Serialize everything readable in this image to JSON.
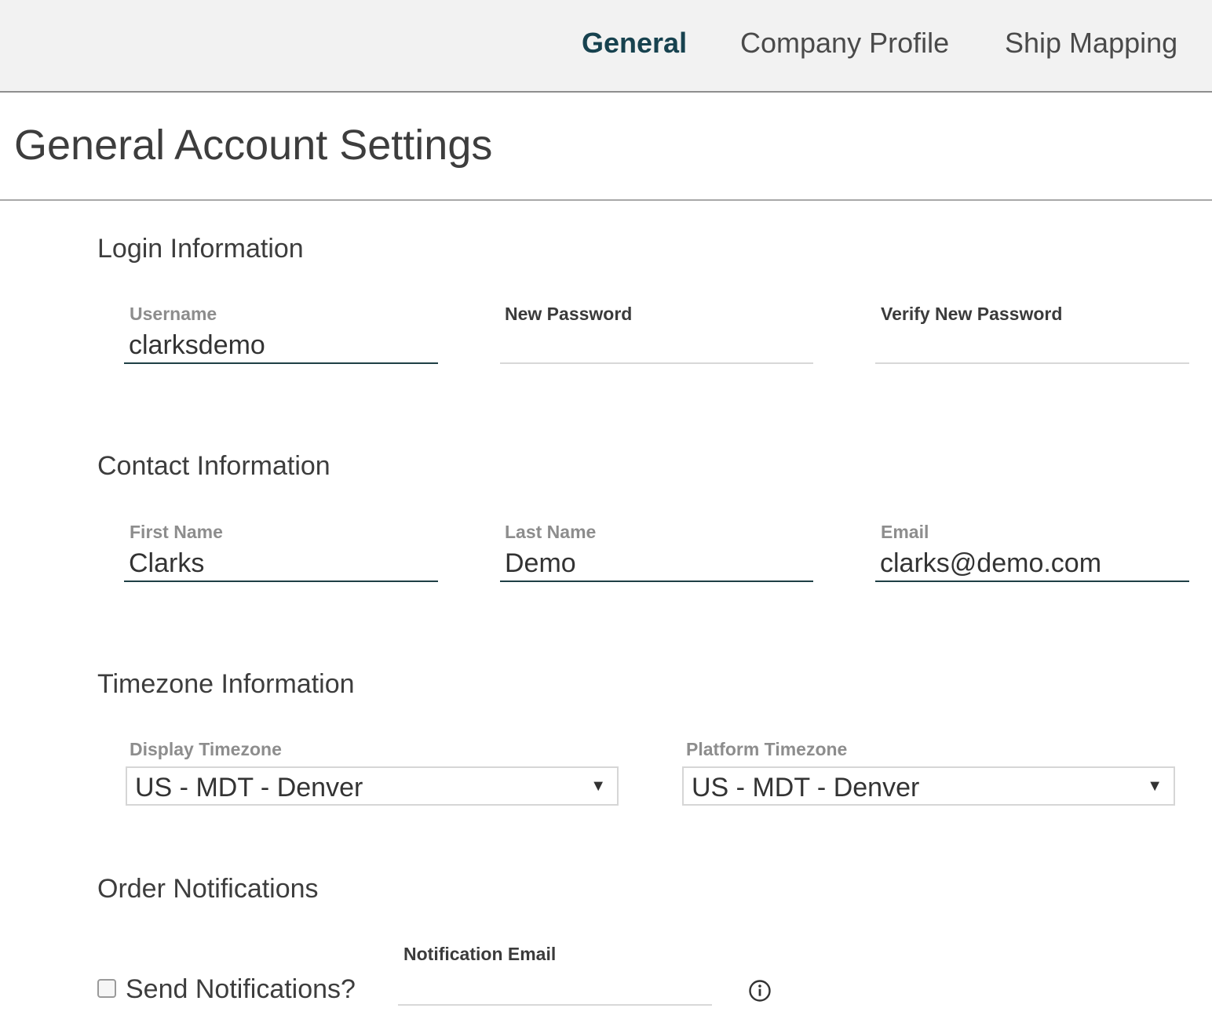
{
  "nav": {
    "tabs": [
      {
        "label": "General",
        "active": true
      },
      {
        "label": "Company Profile",
        "active": false
      },
      {
        "label": "Ship Mapping",
        "active": false
      }
    ]
  },
  "page": {
    "title": "General Account Settings"
  },
  "login": {
    "title": "Login Information",
    "username_label": "Username",
    "username_value": "clarksdemo",
    "new_password_label": "New Password",
    "new_password_value": "",
    "verify_password_label": "Verify New Password",
    "verify_password_value": ""
  },
  "contact": {
    "title": "Contact Information",
    "first_name_label": "First Name",
    "first_name_value": "Clarks",
    "last_name_label": "Last Name",
    "last_name_value": "Demo",
    "email_label": "Email",
    "email_value": "clarks@demo.com"
  },
  "timezone": {
    "title": "Timezone Information",
    "display_label": "Display Timezone",
    "display_value": "US - MDT - Denver",
    "platform_label": "Platform Timezone",
    "platform_value": "US - MDT - Denver"
  },
  "notifications": {
    "title": "Order Notifications",
    "send_label": "Send Notifications?",
    "send_checked": false,
    "email_label": "Notification Email",
    "email_value": ""
  },
  "icons": {
    "dropdown_arrow": "▼",
    "info": "info-icon"
  },
  "colors": {
    "active_tab": "#17424f",
    "input_underline": "#1e3f45",
    "topbar_bg": "#f2f2f2"
  }
}
